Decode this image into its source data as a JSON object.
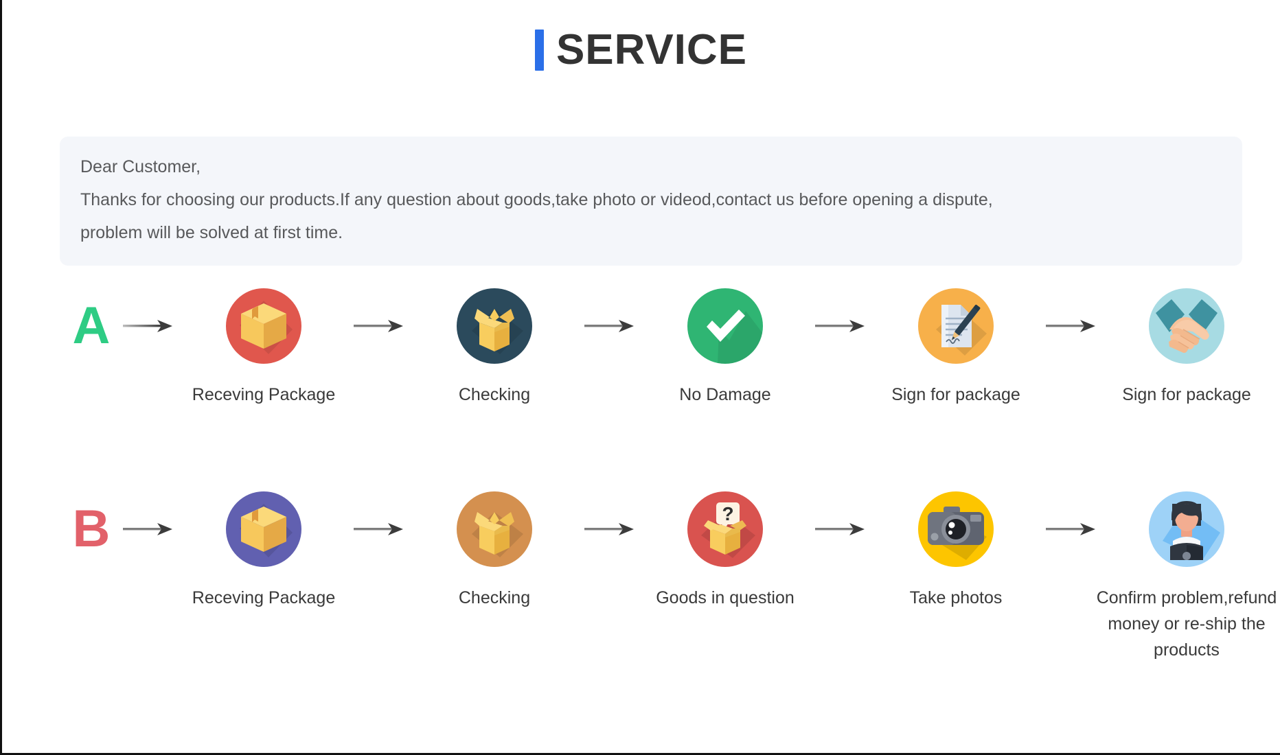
{
  "title": {
    "text": "SERVICE",
    "accent_color": "#2b6fe8",
    "text_color": "#333333"
  },
  "notice": {
    "background": "#f4f6fa",
    "lines": [
      "Dear Customer,",
      "Thanks for choosing our products.If any question about goods,take photo or videod,contact us before opening a dispute,",
      "problem will be solved at first time."
    ]
  },
  "flows": [
    {
      "letter": "A",
      "letter_color": "#2ecc84",
      "steps": [
        {
          "label": "Receving Package",
          "icon": "package-box-icon",
          "circle_color": "#e0574d"
        },
        {
          "label": "Checking",
          "icon": "open-box-icon",
          "circle_color": "#2b4a5c"
        },
        {
          "label": "No Damage",
          "icon": "check-mark-icon",
          "circle_color": "#2fb573"
        },
        {
          "label": "Sign for package",
          "icon": "document-pen-icon",
          "circle_color": "#f5a623"
        },
        {
          "label": "Sign for package",
          "icon": "handshake-icon",
          "circle_color": "#a7dbe3"
        }
      ]
    },
    {
      "letter": "B",
      "letter_color": "#e2616a",
      "steps": [
        {
          "label": "Receving Package",
          "icon": "package-box-icon",
          "circle_color": "#6160b0"
        },
        {
          "label": "Checking",
          "icon": "open-box-icon",
          "circle_color": "#d4904f"
        },
        {
          "label": "Goods in question",
          "icon": "question-box-icon",
          "circle_color": "#d9534f"
        },
        {
          "label": "Take photos",
          "icon": "camera-icon",
          "circle_color": "#fdc500"
        },
        {
          "label": "Confirm problem,refund money or re-ship the products",
          "icon": "support-agent-icon",
          "circle_color": "#9ed2f7"
        }
      ]
    }
  ],
  "arrow": {
    "name": "right-arrow-icon",
    "color": "#4a4a4a"
  }
}
